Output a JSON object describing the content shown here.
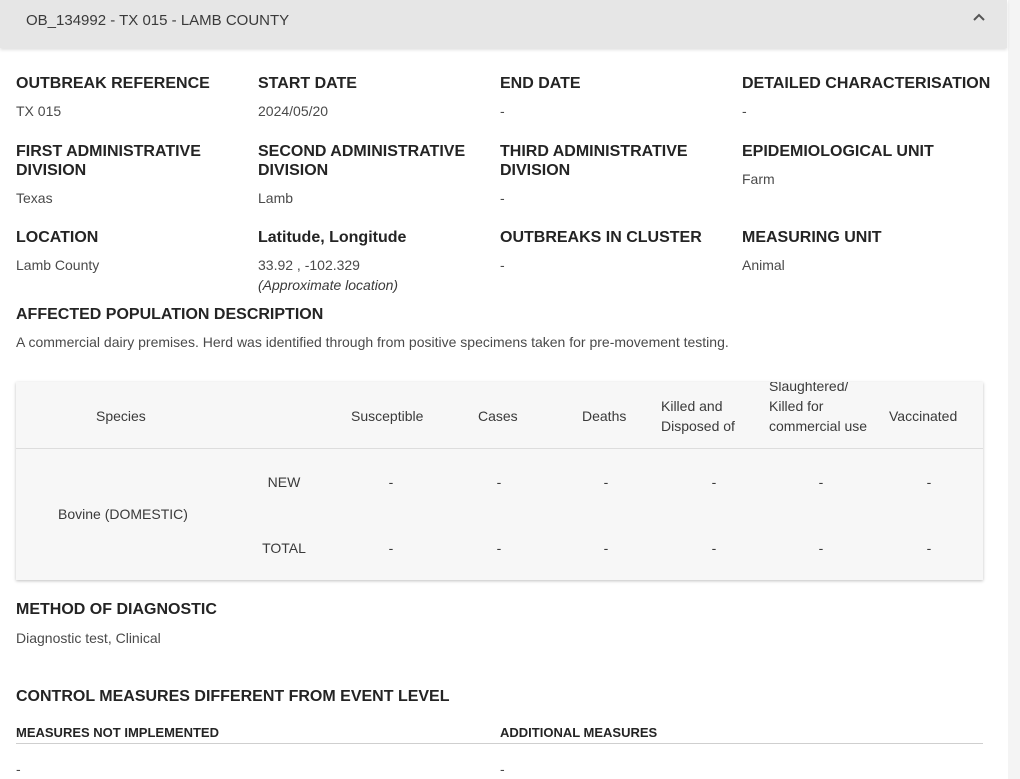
{
  "accordion": {
    "title": "OB_134992 - TX 015 - LAMB COUNTY"
  },
  "fields": {
    "outbreak_reference": {
      "label": "OUTBREAK REFERENCE",
      "value": "TX 015"
    },
    "start_date": {
      "label": "START DATE",
      "value": "2024/05/20"
    },
    "end_date": {
      "label": "END DATE",
      "value": "-"
    },
    "detailed_characterisation": {
      "label": "DETAILED CHARACTERISATION",
      "value": "-"
    },
    "first_admin": {
      "label": "FIRST ADMINISTRATIVE DIVISION",
      "value": "Texas"
    },
    "second_admin": {
      "label": "SECOND ADMINISTRATIVE DIVISION",
      "value": "Lamb"
    },
    "third_admin": {
      "label": "THIRD ADMINISTRATIVE DIVISION",
      "value": "-"
    },
    "epidemiological_unit": {
      "label": "EPIDEMIOLOGICAL UNIT",
      "value": "Farm"
    },
    "location": {
      "label": "LOCATION",
      "value": "Lamb County"
    },
    "lat_long": {
      "label": "Latitude, Longitude",
      "value": "33.92 , -102.329",
      "note": "(Approximate location)"
    },
    "outbreaks_in_cluster": {
      "label": "OUTBREAKS IN CLUSTER",
      "value": "-"
    },
    "measuring_unit": {
      "label": "MEASURING UNIT",
      "value": "Animal"
    }
  },
  "affected_population": {
    "label": "AFFECTED POPULATION DESCRIPTION",
    "text": "A commercial dairy premises. Herd was identified through from positive specimens taken for pre-movement testing."
  },
  "species_table": {
    "headers": [
      "Species",
      "Susceptible",
      "Cases",
      "Deaths",
      "Killed and Disposed of",
      "Slaughtered/ Killed for commercial use",
      "Vaccinated"
    ],
    "species": "Bovine (DOMESTIC)",
    "rows": [
      {
        "type": "NEW",
        "values": [
          "-",
          "-",
          "-",
          "-",
          "-",
          "-"
        ]
      },
      {
        "type": "TOTAL",
        "values": [
          "-",
          "-",
          "-",
          "-",
          "-",
          "-"
        ]
      }
    ]
  },
  "method_of_diagnostic": {
    "label": "METHOD OF DIAGNOSTIC",
    "value": "Diagnostic test, Clinical"
  },
  "control_measures": {
    "label": "CONTROL MEASURES DIFFERENT FROM EVENT LEVEL",
    "not_implemented": {
      "label": "MEASURES NOT IMPLEMENTED",
      "value": "-"
    },
    "additional": {
      "label": "ADDITIONAL MEASURES",
      "value": "-"
    }
  }
}
